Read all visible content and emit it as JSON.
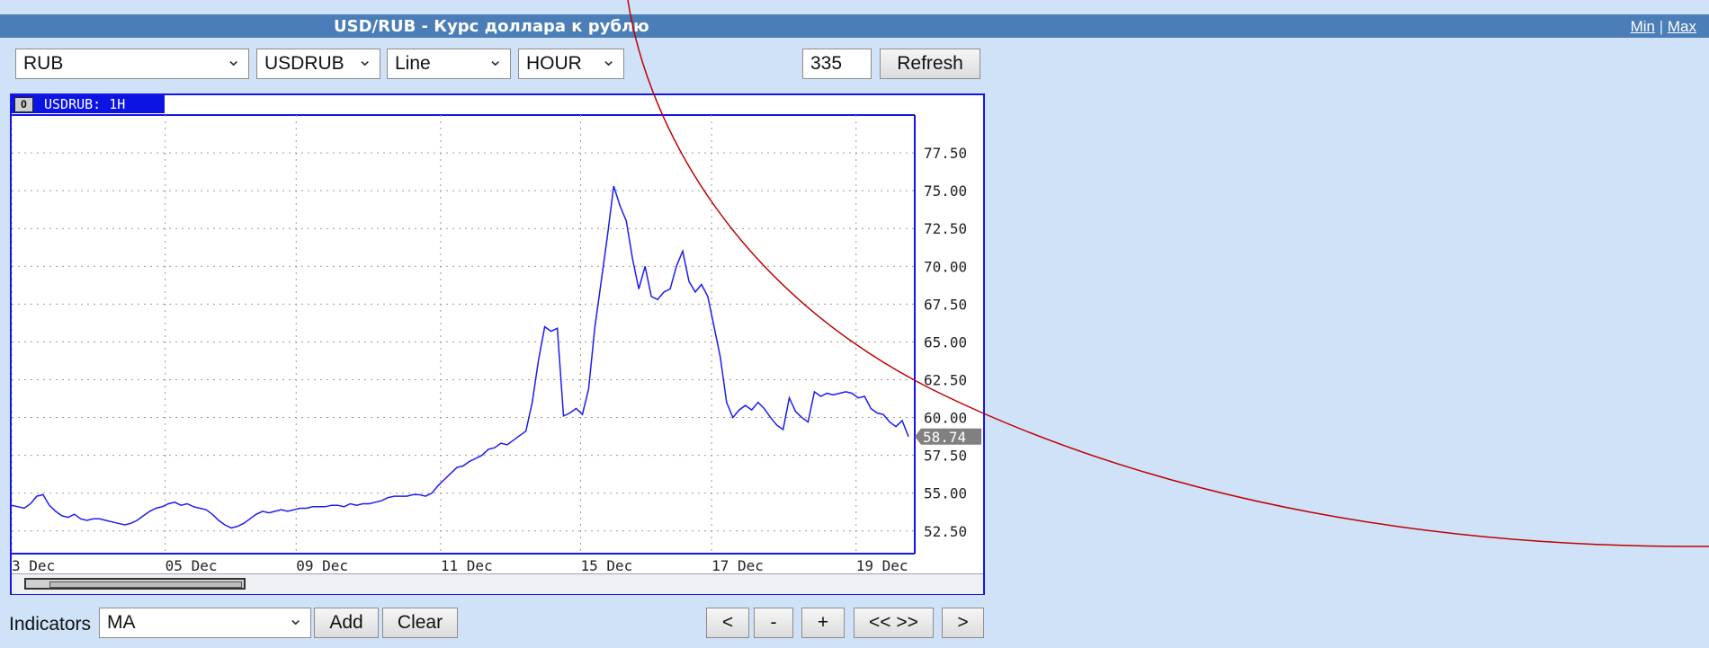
{
  "header": {
    "title": "USD/RUB - Курс доллара к рублю",
    "min_label": "Min",
    "separator": "|",
    "max_label": "Max"
  },
  "toolbar": {
    "currency": "RUB",
    "symbol": "USDRUB",
    "chart_type": "Line",
    "period": "HOUR",
    "count_value": "335",
    "refresh_label": "Refresh"
  },
  "chart_tab": {
    "id": "0",
    "label": "USDRUB: 1H"
  },
  "bottom": {
    "indicators_label": "Indicators",
    "indicator_value": "MA",
    "add_label": "Add",
    "clear_label": "Clear",
    "nav": [
      "<",
      "-",
      "+",
      "<< >>",
      ">"
    ]
  },
  "colors": {
    "line": "#1c1cf0",
    "frame": "#1515e8",
    "titlebar": "#4b7db8",
    "background": "#cfe2f7",
    "overlay_arc": "#c00000"
  },
  "chart_data": {
    "type": "line",
    "series": [
      {
        "values": [
          54.2,
          54.1,
          54.0,
          54.3,
          54.8,
          54.9,
          54.2,
          53.8,
          53.5,
          53.4,
          53.6,
          53.3,
          53.2,
          53.3,
          53.3,
          53.2,
          53.1,
          53.0,
          52.9,
          53.0,
          53.2,
          53.5,
          53.8,
          54.0,
          54.1,
          54.3,
          54.4,
          54.2,
          54.3,
          54.1,
          54.0,
          53.9,
          53.6,
          53.2,
          52.9,
          52.7,
          52.8,
          53.0,
          53.3,
          53.6,
          53.8,
          53.7,
          53.8,
          53.9,
          53.8,
          53.9,
          54.0,
          54.0,
          54.1,
          54.1,
          54.1,
          54.2,
          54.2,
          54.1,
          54.3,
          54.2,
          54.3,
          54.3,
          54.4,
          54.5,
          54.7,
          54.8,
          54.8,
          54.8,
          54.9,
          54.9,
          54.8,
          55.0,
          55.5,
          55.9,
          56.3,
          56.7,
          56.8,
          57.1,
          57.3,
          57.5,
          57.9,
          58.0,
          58.3,
          58.2,
          58.5,
          58.8,
          59.1,
          61.0,
          63.8,
          66.0,
          65.7,
          65.9,
          60.1,
          60.3,
          60.6,
          60.2,
          61.9,
          66.0,
          69.0,
          72.0,
          75.3,
          74.0,
          73.0,
          70.5,
          68.5,
          70.0,
          68.0,
          67.8,
          68.3,
          68.5,
          70.0,
          71.0,
          69.0,
          68.3,
          68.8,
          68.0,
          66.0,
          64.0,
          61.0,
          60.0,
          60.5,
          60.8,
          60.5,
          61.0,
          60.6,
          60.0,
          59.5,
          59.2,
          61.3,
          60.4,
          60.0,
          59.7,
          61.7,
          61.4,
          61.6,
          61.5,
          61.6,
          61.7,
          61.6,
          61.3,
          61.4,
          60.6,
          60.3,
          60.2,
          59.7,
          59.4,
          59.8,
          58.74
        ]
      }
    ],
    "x_tick_labels": [
      "3 Dec",
      "05 Dec",
      "09 Dec",
      "11 Dec",
      "15 Dec",
      "17 Dec",
      "19 Dec"
    ],
    "y_tick_labels": [
      "77.50",
      "75.00",
      "72.50",
      "70.00",
      "67.50",
      "65.00",
      "62.50",
      "60.00",
      "57.50",
      "55.00",
      "52.50"
    ],
    "ylim": [
      51.0,
      80.0
    ],
    "last_value_label": "58.74",
    "grid": true
  }
}
